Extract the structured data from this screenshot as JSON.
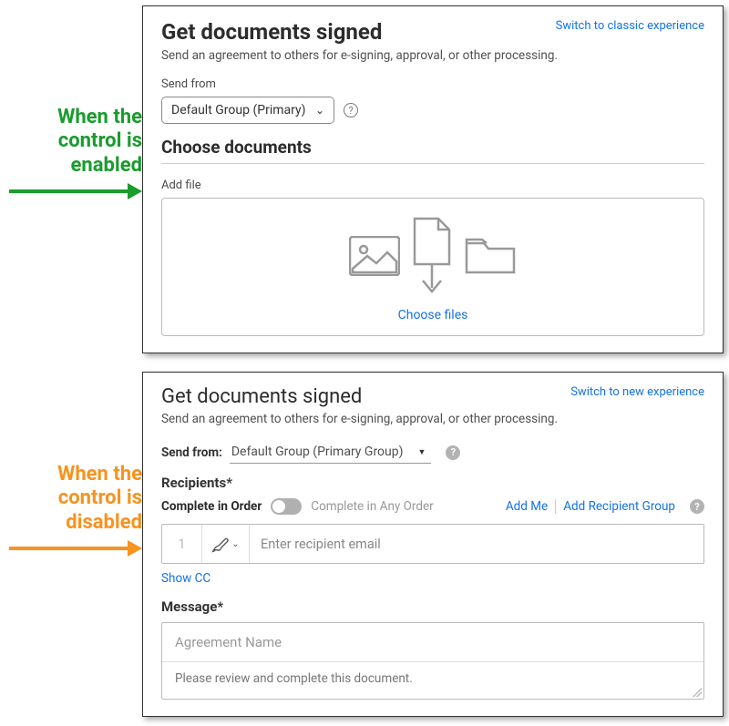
{
  "annotations": {
    "enabled_label_l1": "When the",
    "enabled_label_l2": "control is",
    "enabled_label_l3": "enabled",
    "disabled_label_l1": "When the",
    "disabled_label_l2": "control is",
    "disabled_label_l3": "disabled"
  },
  "panel1": {
    "switch_link": "Switch to classic experience",
    "title": "Get documents signed",
    "subtitle": "Send an agreement to others for e-signing, approval, or other processing.",
    "send_from_label": "Send from",
    "send_from_value": "Default Group (Primary)",
    "section_title": "Choose documents",
    "add_file_label": "Add file",
    "choose_files": "Choose files"
  },
  "panel2": {
    "switch_link": "Switch to new experience",
    "title": "Get documents signed",
    "subtitle": "Send an agreement to others for e-signing, approval, or other processing.",
    "send_from_label": "Send from:",
    "send_from_value": "Default Group (Primary Group)",
    "recipients_label": "Recipients*",
    "complete_in_order": "Complete in Order",
    "complete_any_order": "Complete in Any Order",
    "add_me": "Add Me",
    "add_recipient_group": "Add Recipient Group",
    "recipient_index": "1",
    "recipient_placeholder": "Enter recipient email",
    "show_cc": "Show CC",
    "message_label": "Message*",
    "agreement_name_placeholder": "Agreement Name",
    "message_body": "Please review and complete this document."
  }
}
